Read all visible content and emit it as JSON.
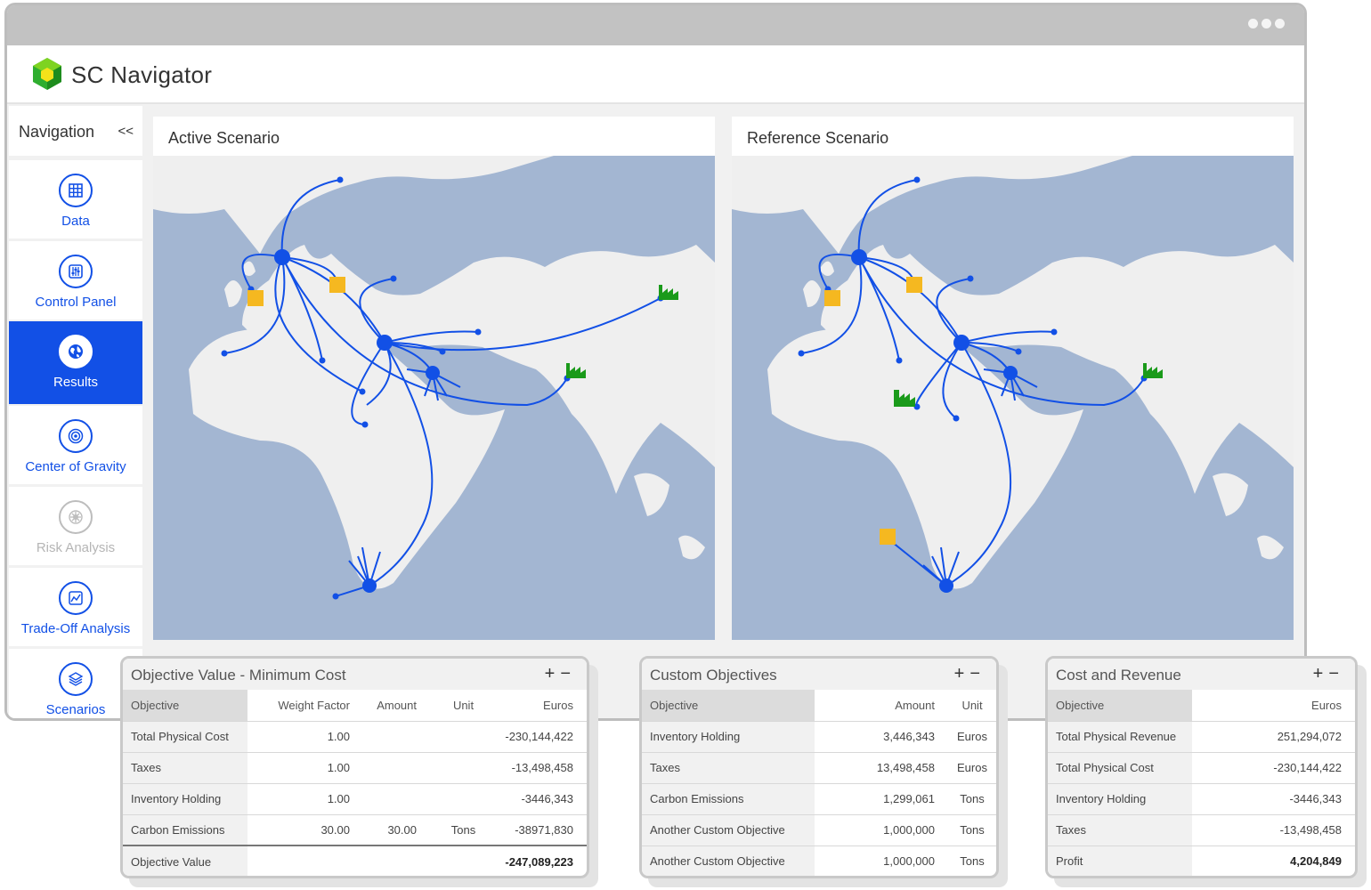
{
  "app": {
    "title": "SC Navigator"
  },
  "navigation": {
    "header": "Navigation",
    "collapse_label": "<<",
    "items": [
      {
        "label": "Data",
        "icon": "grid-icon",
        "state": "normal"
      },
      {
        "label": "Control Panel",
        "icon": "sliders-icon",
        "state": "normal"
      },
      {
        "label": "Results",
        "icon": "globe-icon",
        "state": "active"
      },
      {
        "label": "Center of Gravity",
        "icon": "target-icon",
        "state": "normal"
      },
      {
        "label": "Risk Analysis",
        "icon": "risk-icon",
        "state": "disabled"
      },
      {
        "label": "Trade-Off Analysis",
        "icon": "chart-icon",
        "state": "normal"
      },
      {
        "label": "Scenarios",
        "icon": "layers-icon",
        "state": "normal"
      }
    ]
  },
  "maps": {
    "active": {
      "title": "Active Scenario"
    },
    "reference": {
      "title": "Reference Scenario"
    }
  },
  "objective_value": {
    "title": "Objective Value - Minimum Cost",
    "plus": "+",
    "minus": "−",
    "headers": [
      "Objective",
      "Weight Factor",
      "Amount",
      "Unit",
      "Euros"
    ],
    "rows": [
      [
        "Total Physical Cost",
        "1.00",
        "",
        "",
        "-230,144,422"
      ],
      [
        "Taxes",
        "1.00",
        "",
        "",
        "-13,498,458"
      ],
      [
        "Inventory Holding",
        "1.00",
        "",
        "",
        "-3446,343"
      ],
      [
        "Carbon Emissions",
        "30.00",
        "30.00",
        "Tons",
        "-38971,830"
      ]
    ],
    "total": [
      "Objective Value",
      "",
      "",
      "",
      "-247,089,223"
    ]
  },
  "custom_objectives": {
    "title": "Custom Objectives",
    "plus": "+",
    "minus": "−",
    "headers": [
      "Objective",
      "Amount",
      "Unit"
    ],
    "rows": [
      [
        "Inventory Holding",
        "3,446,343",
        "Euros"
      ],
      [
        "Taxes",
        "13,498,458",
        "Euros"
      ],
      [
        "Carbon Emissions",
        "1,299,061",
        "Tons"
      ],
      [
        "Another Custom Objective",
        "1,000,000",
        "Tons"
      ],
      [
        "Another Custom Objective",
        "1,000,000",
        "Tons"
      ]
    ]
  },
  "cost_revenue": {
    "title": "Cost and Revenue",
    "plus": "+",
    "minus": "−",
    "headers": [
      "Objective",
      "Euros"
    ],
    "rows": [
      [
        "Total Physical Revenue",
        "251,294,072"
      ],
      [
        "Total Physical Cost",
        "-230,144,422"
      ],
      [
        "Inventory Holding",
        "-3446,343"
      ],
      [
        "Taxes",
        "-13,498,458"
      ]
    ],
    "total": [
      "Profit",
      "4,204,849"
    ]
  },
  "colors": {
    "accent": "#1250e6",
    "ocean": "#a3b6d2",
    "land": "#efefef",
    "warehouse": "#f5b820",
    "factory": "#1a9a1a"
  }
}
